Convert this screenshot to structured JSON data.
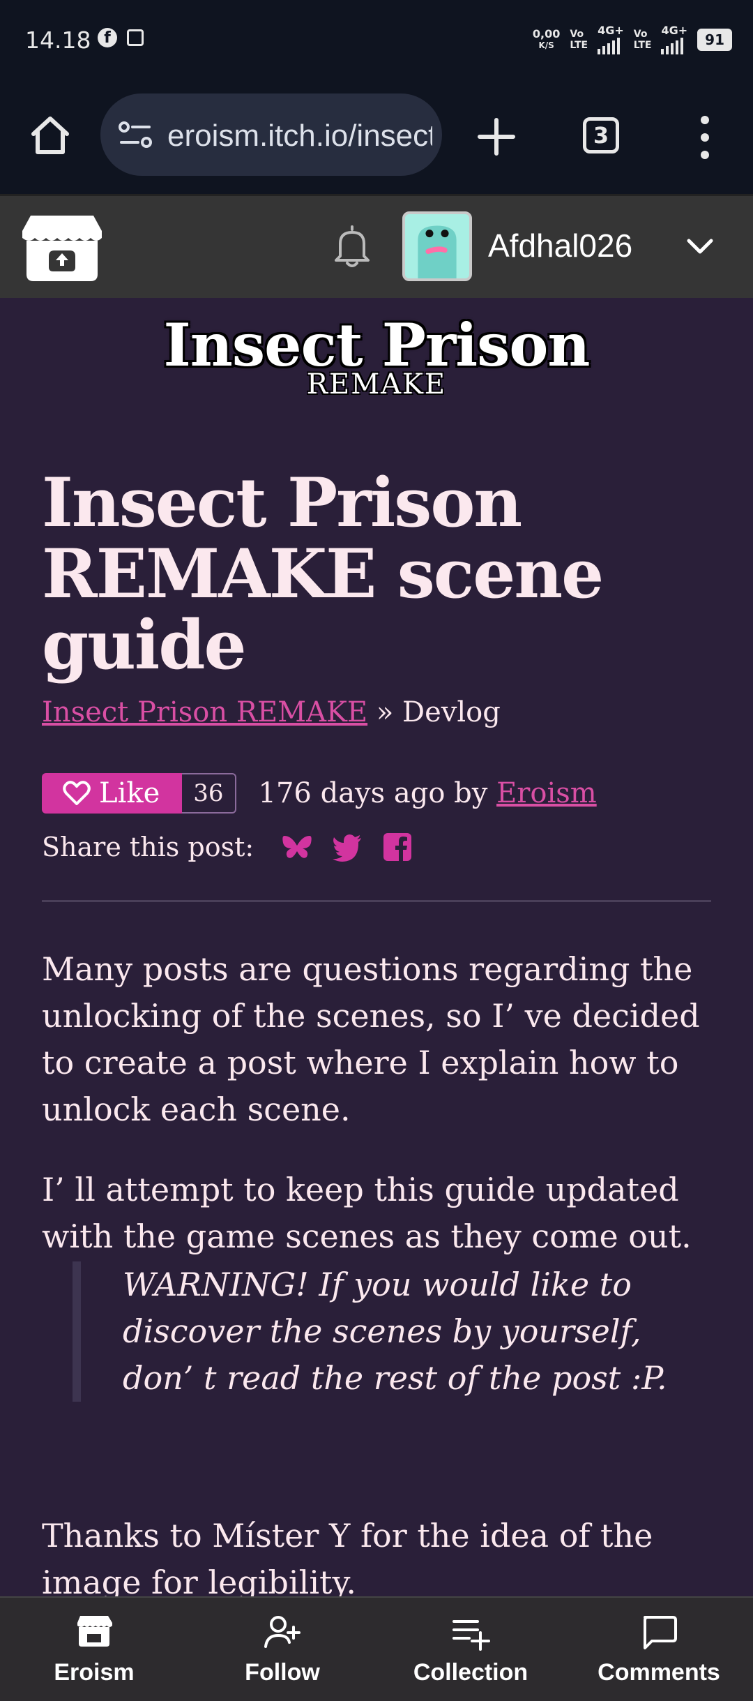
{
  "status": {
    "time": "14.18",
    "net_speed_value": "0,00",
    "net_speed_unit": "K/S",
    "sim1_label": "Vo\nLTE",
    "sim1_type": "4G+",
    "sim2_label": "Vo\nLTE",
    "sim2_type": "4G+",
    "battery": "91"
  },
  "browser": {
    "url": "eroism.itch.io/insect",
    "tab_count": "3"
  },
  "itch_header": {
    "username": "Afdhal026"
  },
  "banner": {
    "title": "Insect Prison",
    "subtitle": "REMAKE"
  },
  "post": {
    "title": "Insect Prison REMAKE scene guide",
    "breadcrumb_link": "Insect Prison REMAKE",
    "breadcrumb_sep": "»",
    "breadcrumb_current": "Devlog",
    "like_label": "Like",
    "like_count": "36",
    "meta_prefix": "176 days ago by",
    "author": "Eroism",
    "share_label": "Share this post:",
    "paragraph1": "Many posts are questions regarding the unlocking of the scenes, so I’ ve decided to create a post where I explain how to unlock each scene.",
    "paragraph2": "I’ ll attempt to keep this guide updated with the game scenes as they come out.",
    "warning": "WARNING! If you would like to discover the scenes by yourself, don’ t read the rest of the post :P.",
    "paragraph3": "Thanks to Míster Y for the idea of the image for legibility."
  },
  "colors": {
    "accent": "#d2349f",
    "background": "#2a1f39",
    "text": "#fbe8ee"
  },
  "bottom_nav": [
    {
      "label": "Eroism",
      "icon": "itch-logo-icon"
    },
    {
      "label": "Follow",
      "icon": "add-person-icon"
    },
    {
      "label": "Collection",
      "icon": "playlist-add-icon"
    },
    {
      "label": "Comments",
      "icon": "comment-icon"
    }
  ]
}
